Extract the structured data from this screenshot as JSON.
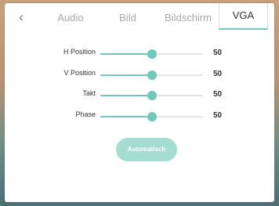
{
  "tabs": {
    "back_icon": "chevron-left-icon",
    "audio": "Audio",
    "bild": "Bild",
    "bildschirm": "Bildschirm",
    "vga": "VGA",
    "active": "VGA"
  },
  "settings": [
    {
      "label": "H Position",
      "value": "50",
      "level": 0.5
    },
    {
      "label": "V Position",
      "value": "50",
      "level": 0.5
    },
    {
      "label": "Takt",
      "value": "50",
      "level": 0.5
    },
    {
      "label": "Phase",
      "value": "50",
      "level": 0.5
    }
  ],
  "auto_button": "Automatisch",
  "colors": {
    "accent": "#6ec9b9",
    "button_bg": "#a6ddd3",
    "track": "#e4e4e4"
  }
}
